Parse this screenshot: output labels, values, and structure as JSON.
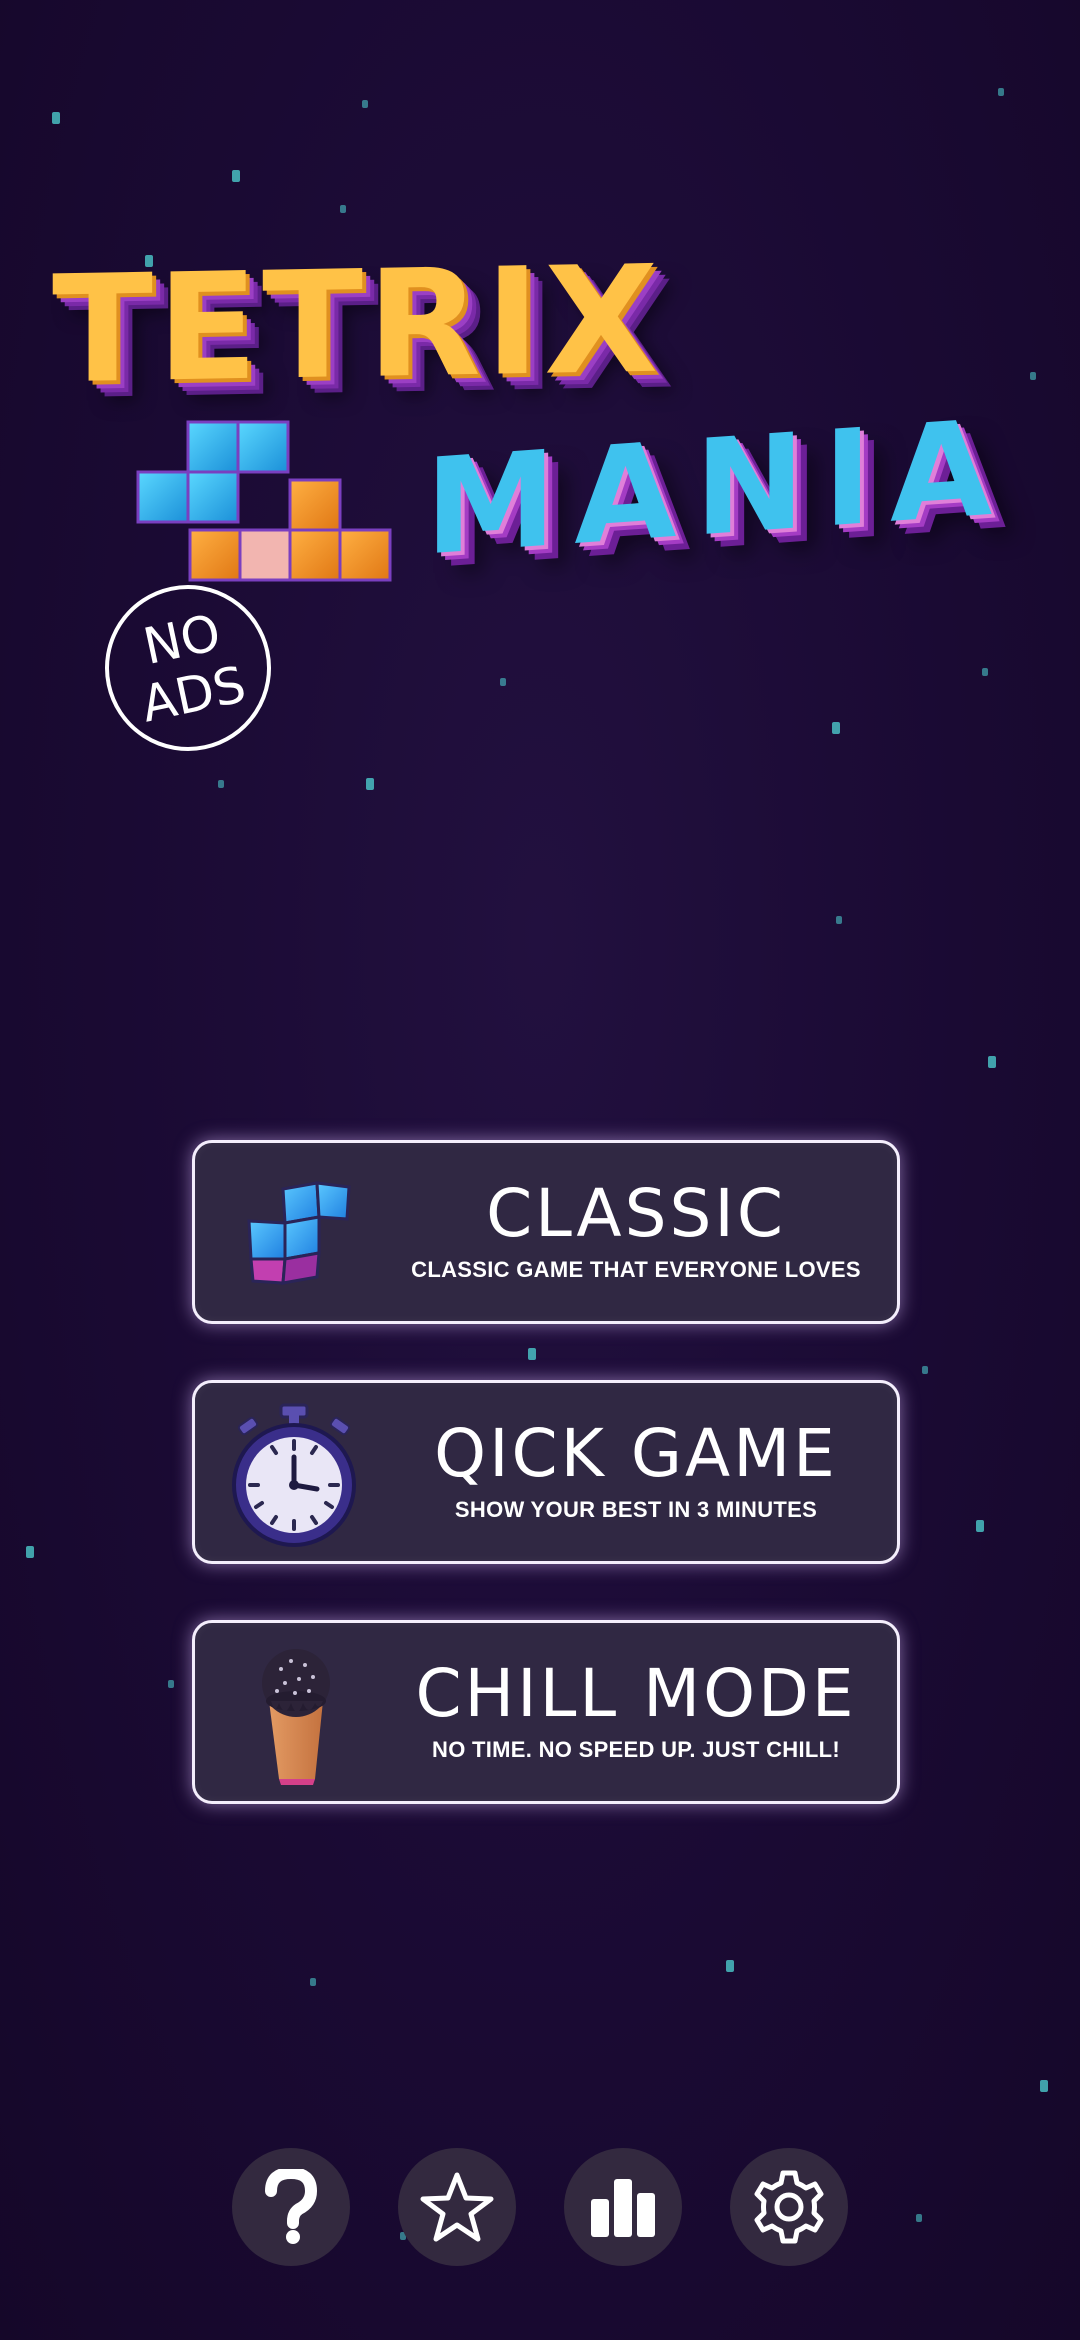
{
  "logo": {
    "title": "TETRIX",
    "subtitle": "MANIA",
    "badge_line1": "NO",
    "badge_line2": "ADS"
  },
  "modes": [
    {
      "title": "CLASSIC",
      "subtitle": "CLASSIC GAME THAT EVERYONE LOVES",
      "icon": "tetromino-icon"
    },
    {
      "title": "QICK GAME",
      "subtitle": "SHOW YOUR BEST IN 3 MINUTES",
      "icon": "stopwatch-icon"
    },
    {
      "title": "CHILL MODE",
      "subtitle": "NO TIME. NO SPEED UP. JUST CHILL!",
      "icon": "ice-cream-icon"
    }
  ],
  "bottom_nav": [
    {
      "icon": "help-icon"
    },
    {
      "icon": "star-icon"
    },
    {
      "icon": "leaderboard-icon"
    },
    {
      "icon": "settings-icon"
    }
  ],
  "colors": {
    "background": "#1a0a33",
    "button_fill": "#302843",
    "button_border": "#f4eefc",
    "title_yellow": "#ffc247",
    "title_blue": "#3fc2ee",
    "star": "#4fd6d6"
  }
}
